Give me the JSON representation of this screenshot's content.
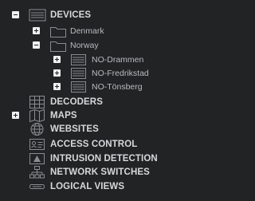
{
  "tree": {
    "devices": {
      "label": "DEVICES",
      "icon": "devices-list-icon",
      "expanded": true,
      "children": {
        "denmark": {
          "label": "Denmark",
          "icon": "folder-icon",
          "expanded": false
        },
        "norway": {
          "label": "Norway",
          "icon": "folder-icon",
          "expanded": true,
          "children": {
            "drammen": {
              "label": "NO-Drammen",
              "icon": "device-list-icon",
              "expanded": false
            },
            "fredrikstad": {
              "label": "NO-Fredrikstad",
              "icon": "device-list-icon",
              "expanded": false
            },
            "tonsberg": {
              "label": "NO-Tönsberg",
              "icon": "device-list-icon",
              "expanded": false
            }
          }
        }
      }
    },
    "decoders": {
      "label": "DECODERS",
      "icon": "decoder-grid-icon"
    },
    "maps": {
      "label": "MAPS",
      "icon": "map-icon",
      "expanded": false
    },
    "websites": {
      "label": "WEBSITES",
      "icon": "globe-icon"
    },
    "access_control": {
      "label": "ACCESS CONTROL",
      "icon": "id-card-icon"
    },
    "intrusion_detection": {
      "label": "INTRUSION DETECTION",
      "icon": "alarm-panel-icon"
    },
    "network_switches": {
      "label": "NETWORK SWITCHES",
      "icon": "network-switch-icon"
    },
    "logical_views": {
      "label": "LOGICAL VIEWS",
      "icon": "logical-view-icon"
    }
  },
  "colors": {
    "background": "#212325",
    "text": "#d6d8da",
    "icon_stroke": "#8a8d91",
    "toggle": "#eef0f2"
  }
}
